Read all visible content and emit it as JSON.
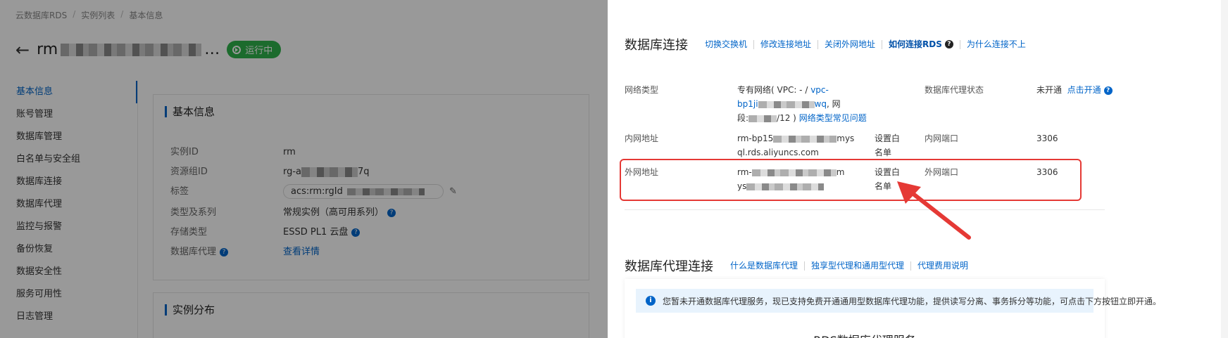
{
  "breadcrumb": [
    "云数据库RDS",
    "实例列表",
    "基本信息"
  ],
  "instance": {
    "title_prefix": "rm",
    "title_suffix": "…",
    "status": "运行中"
  },
  "left_nav": [
    {
      "label": "基本信息",
      "active": true
    },
    {
      "label": "账号管理"
    },
    {
      "label": "数据库管理"
    },
    {
      "label": "白名单与安全组"
    },
    {
      "label": "数据库连接"
    },
    {
      "label": "数据库代理"
    },
    {
      "label": "监控与报警"
    },
    {
      "label": "备份恢复"
    },
    {
      "label": "数据安全性"
    },
    {
      "label": "服务可用性"
    },
    {
      "label": "日志管理"
    }
  ],
  "basic_info": {
    "title": "基本信息",
    "rows": [
      {
        "key": "实例ID",
        "value": "rm"
      },
      {
        "key": "资源组ID",
        "value_prefix": "rg-a",
        "value_suffix": "7q"
      },
      {
        "key": "标签",
        "value": "acs:rm:rgId"
      },
      {
        "key": "类型及系列",
        "value": "常规实例（高可用系列）"
      },
      {
        "key": "存储类型",
        "value": "ESSD PL1 云盘"
      },
      {
        "key": "数据库代理",
        "value": "查看详情"
      }
    ]
  },
  "distribution": {
    "title": "实例分布"
  },
  "db_connection": {
    "title": "数据库连接",
    "links": [
      "切换交换机",
      "修改连接地址",
      "关闭外网地址",
      "如何连接RDS",
      "为什么连接不上"
    ],
    "network_type": {
      "key": "网络类型",
      "line1": "专有网络( VPC: - / ",
      "vpc_link": "vpc-",
      "line2_prefix": "bp1ji",
      "line2_link": "wq",
      "line2_suffix": ", 网",
      "line3_prefix": "段:",
      "line3_mid": "/12 )",
      "faq_link": "网络类型常见问题"
    },
    "proxy_status": {
      "key": "数据库代理状态",
      "value": "未开通",
      "link": "点击开通"
    },
    "internal": {
      "key": "内网地址",
      "addr_line1_prefix": "rm-bp15",
      "addr_line1_suffix": "mys",
      "addr_line2": "ql.rds.aliyuncs.com",
      "whitelist": [
        "设置白",
        "名单"
      ],
      "port_key": "内网端口",
      "port": "3306"
    },
    "external": {
      "key": "外网地址",
      "addr_line1_prefix": "rm-",
      "addr_line1_suffix": "m",
      "addr_line2_prefix": "ys",
      "whitelist": [
        "设置白",
        "名单"
      ],
      "port_key": "外网端口",
      "port": "3306"
    }
  },
  "proxy_connection": {
    "title": "数据库代理连接",
    "links": [
      "什么是数据库代理",
      "独享型代理和通用型代理",
      "代理费用说明"
    ],
    "notice": "您暂未开通数据库代理服务，现已支持免费开通通用型数据库代理功能，提供读写分离、事务拆分等功能，可点击下方按钮立即开通。",
    "service_title": "RDS数据库代理服务"
  },
  "colors": {
    "link": "#0064c8",
    "highlight": "#e53935",
    "status": "#2fb24b"
  }
}
